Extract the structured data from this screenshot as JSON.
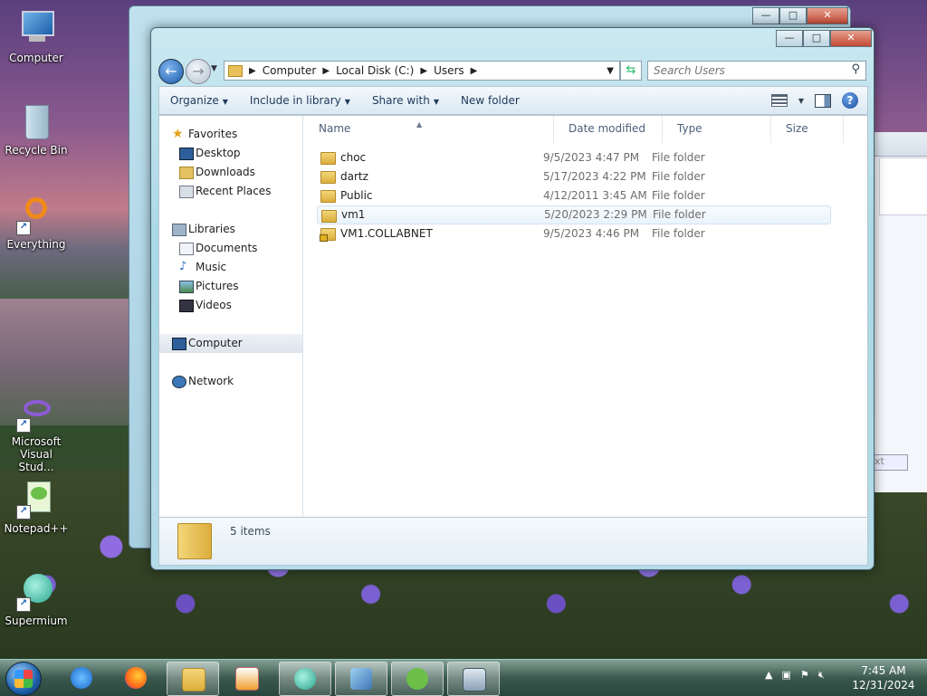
{
  "desktop": {
    "icons": [
      {
        "label": "Computer"
      },
      {
        "label": "Recycle Bin"
      },
      {
        "label": "Everything"
      },
      {
        "label": "Microsoft Visual Stud..."
      },
      {
        "label": "Notepad++"
      },
      {
        "label": "Supermium"
      }
    ]
  },
  "window_controls": {
    "minimize": "—",
    "maximize": "□",
    "close": "✕"
  },
  "explorer": {
    "breadcrumb": [
      "Computer",
      "Local Disk (C:)",
      "Users"
    ],
    "search_placeholder": "Search Users",
    "toolbar": {
      "organize": "Organize",
      "include_in_library": "Include in library",
      "share_with": "Share with",
      "new_folder": "New folder"
    },
    "nav": {
      "favorites": "Favorites",
      "favorites_items": [
        "Desktop",
        "Downloads",
        "Recent Places"
      ],
      "libraries": "Libraries",
      "libraries_items": [
        "Documents",
        "Music",
        "Pictures",
        "Videos"
      ],
      "computer": "Computer",
      "network": "Network"
    },
    "columns": {
      "name": "Name",
      "date": "Date modified",
      "type": "Type",
      "size": "Size"
    },
    "files": [
      {
        "name": "choc",
        "date": "9/5/2023 4:47 PM",
        "type": "File folder"
      },
      {
        "name": "dartz",
        "date": "5/17/2023 4:22 PM",
        "type": "File folder"
      },
      {
        "name": "Public",
        "date": "4/12/2011 3:45 AM",
        "type": "File folder"
      },
      {
        "name": "vm1",
        "date": "5/20/2023 2:29 PM",
        "type": "File folder"
      },
      {
        "name": "VM1.COLLABNET",
        "date": "9/5/2023 4:46 PM",
        "type": "File folder"
      }
    ],
    "status": "5 items"
  },
  "bg_window": {
    "button_partial": "xt"
  },
  "taskbar": {
    "time": "7:45 AM",
    "date": "12/31/2024",
    "colors": {
      "accent": "#1d5ea8"
    }
  }
}
